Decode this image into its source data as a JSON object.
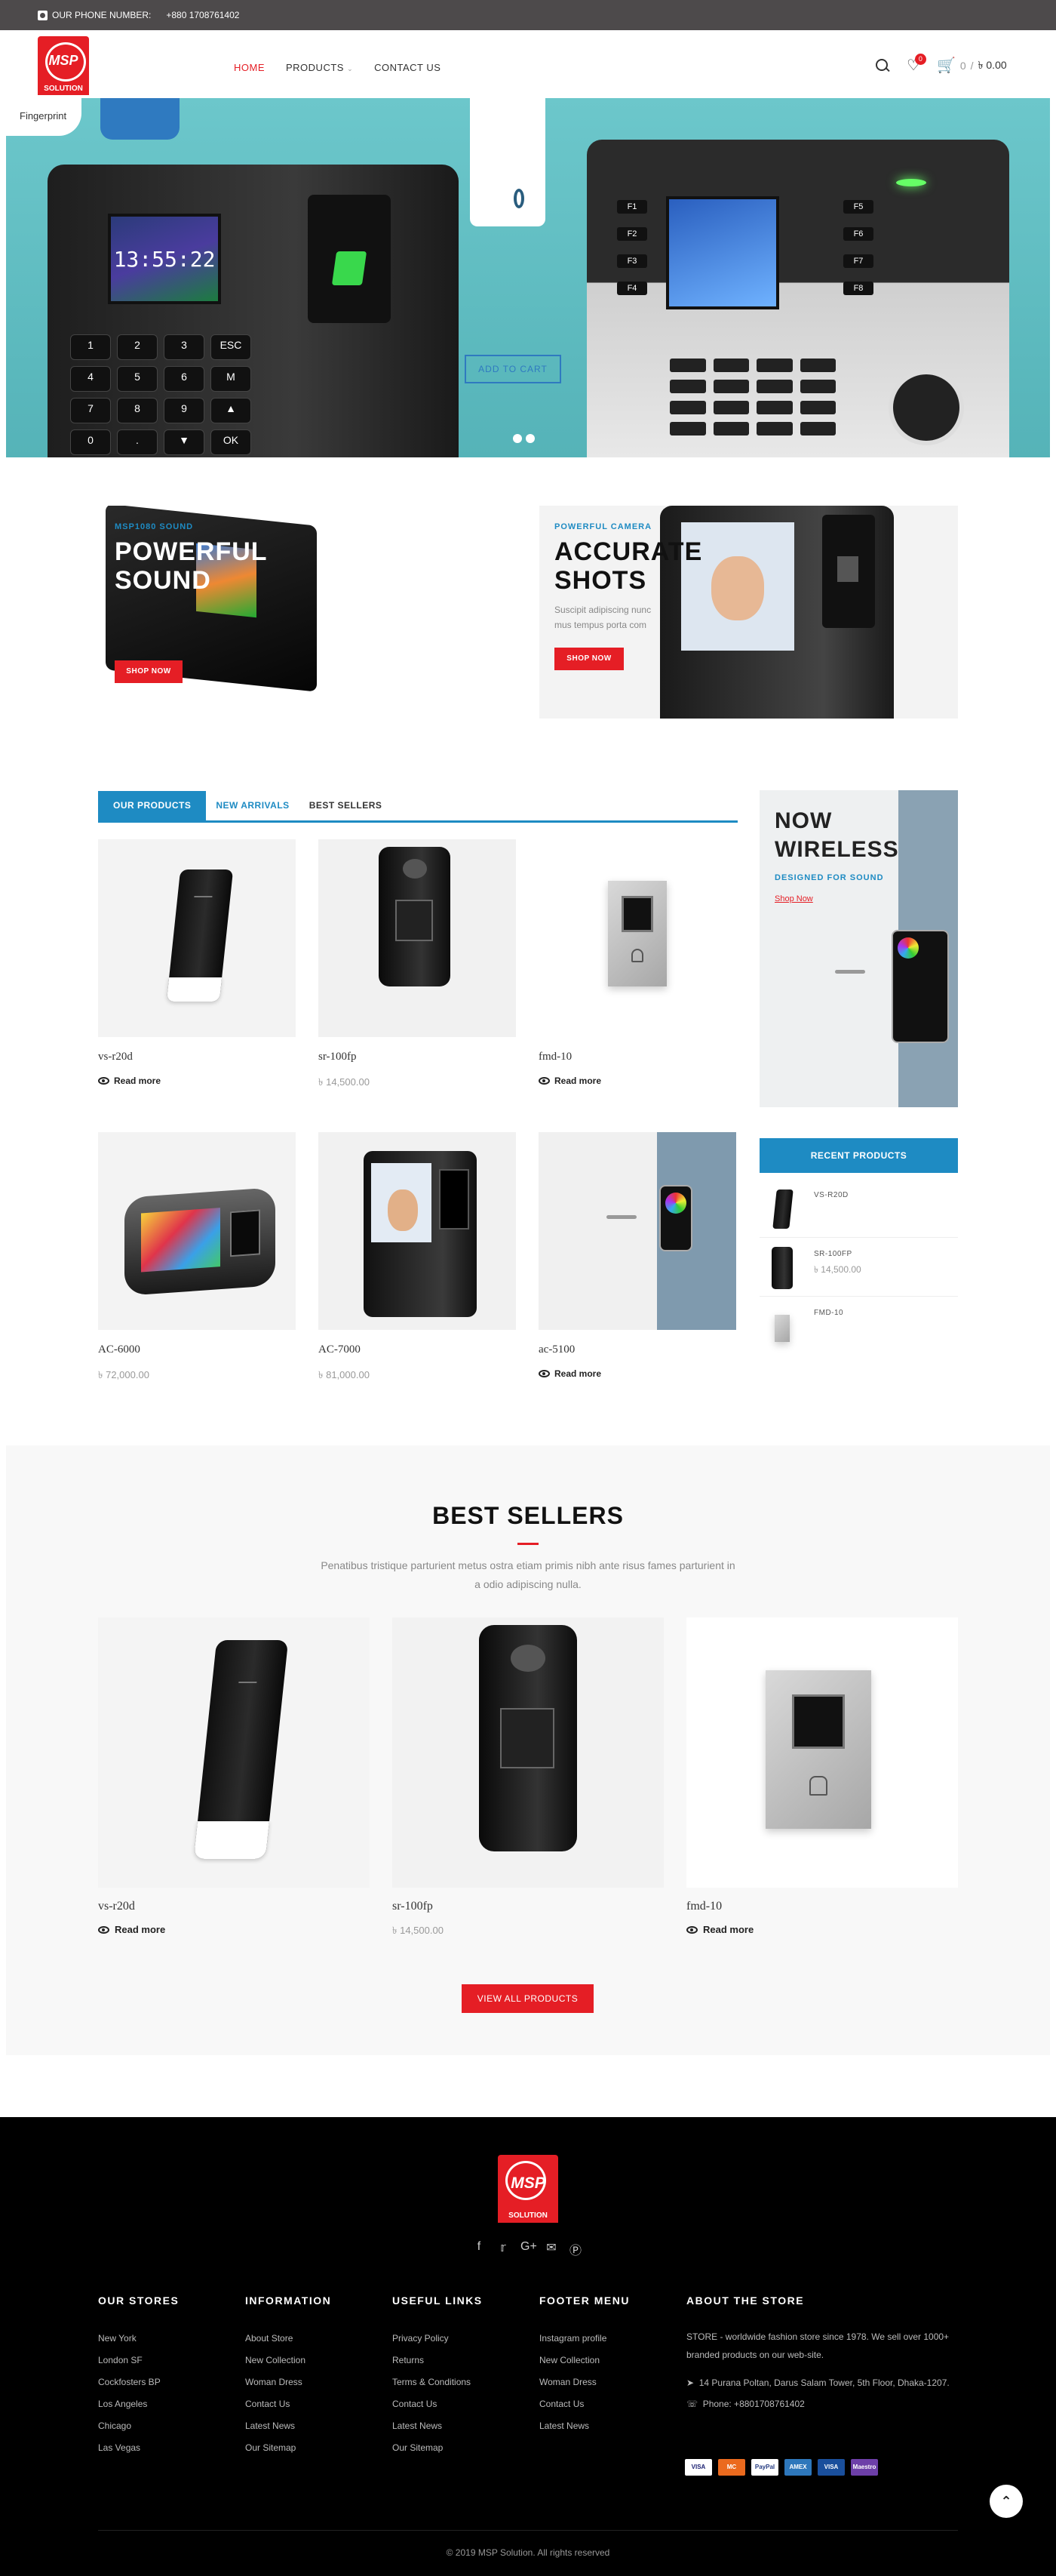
{
  "topbar": {
    "label": "OUR PHONE NUMBER:",
    "phone": "+880 1708761402"
  },
  "brand": {
    "logo_text": "MSP",
    "logo_sub": "SOLUTION"
  },
  "nav": {
    "home": "HOME",
    "products": "PRODUCTS",
    "contact": "CONTACT US"
  },
  "header": {
    "wishlist_count": "0",
    "cart_count": "0",
    "cart_total": "৳ 0.00",
    "cart_sep": "/"
  },
  "hero": {
    "fingerprint_label": "Fingerprint",
    "time": "13:55:22",
    "cta": "ADD TO CART"
  },
  "promo1": {
    "kicker": "MSP1080 SOUND",
    "headline_1": "POWERFUL",
    "headline_2": "SOUND",
    "cta": "SHOP NOW"
  },
  "promo2": {
    "kicker": "POWERFUL CAMERA",
    "headline_1": "ACCURATE",
    "headline_2": "SHOTS",
    "sub_1": "Suscipit adipiscing nunc",
    "sub_2": "mus tempus porta com",
    "cta": "SHOP NOW"
  },
  "tabs": {
    "our_products": "OUR PRODUCTS",
    "new_arrivals": "NEW ARRIVALS",
    "best_sellers": "BEST SELLERS"
  },
  "products": [
    {
      "name": "vs-r20d",
      "action": "Read more",
      "price": ""
    },
    {
      "name": "sr-100fp",
      "action": "",
      "price": "৳ 14,500.00"
    },
    {
      "name": "fmd-10",
      "action": "Read more",
      "price": ""
    },
    {
      "name": "AC-6000",
      "action": "",
      "price": "৳ 72,000.00"
    },
    {
      "name": "AC-7000",
      "action": "",
      "price": "৳ 81,000.00"
    },
    {
      "name": "ac-5100",
      "action": "Read more",
      "price": ""
    }
  ],
  "side_banner": {
    "line1": "NOW",
    "line2": "WIRELESS",
    "kicker": "DESIGNED FOR SOUND",
    "link": "Shop Now"
  },
  "recent": {
    "title": "RECENT PRODUCTS",
    "items": [
      {
        "name": "VS-R20D",
        "price": ""
      },
      {
        "name": "SR-100FP",
        "price": "৳ 14,500.00"
      },
      {
        "name": "FMD-10",
        "price": ""
      }
    ]
  },
  "best": {
    "title": "BEST SELLERS",
    "desc": "Penatibus tristique parturient metus ostra etiam primis nibh ante risus fames parturient in a odio adipiscing nulla.",
    "items": [
      {
        "name": "vs-r20d",
        "action": "Read more",
        "price": ""
      },
      {
        "name": "sr-100fp",
        "action": "",
        "price": "৳ 14,500.00"
      },
      {
        "name": "fmd-10",
        "action": "Read more",
        "price": ""
      }
    ],
    "cta": "VIEW ALL PRODUCTS"
  },
  "footer": {
    "stores": {
      "title": "OUR STORES",
      "items": [
        "New York",
        "London SF",
        "Cockfosters BP",
        "Los Angeles",
        "Chicago",
        "Las Vegas"
      ]
    },
    "info": {
      "title": "INFORMATION",
      "items": [
        "About Store",
        "New Collection",
        "Woman Dress",
        "Contact Us",
        "Latest News",
        "Our Sitemap"
      ]
    },
    "links": {
      "title": "USEFUL LINKS",
      "items": [
        "Privacy Policy",
        "Returns",
        "Terms & Conditions",
        "Contact Us",
        "Latest News",
        "Our Sitemap"
      ]
    },
    "menu": {
      "title": "FOOTER MENU",
      "items": [
        "Instagram profile",
        "New Collection",
        "Woman Dress",
        "Contact Us",
        "Latest News"
      ]
    },
    "about": {
      "title": "ABOUT THE STORE",
      "text": "STORE - worldwide fashion store since 1978. We sell over 1000+ branded products on our web-site.",
      "address": "14 Purana Poltan, Darus Salam Tower, 5th Floor, Dhaka-1207.",
      "phone": "Phone: +8801708761402"
    },
    "payments": [
      "VISA",
      "MC",
      "PayPal",
      "AMEX",
      "VISA",
      "Maestro"
    ],
    "copyright": "© 2019 MSP Solution. All rights reserved"
  },
  "colors": {
    "accent": "#e51e25",
    "blue": "#1e8bc3",
    "topbar": "#4d4a4b",
    "footer": "#000000"
  }
}
